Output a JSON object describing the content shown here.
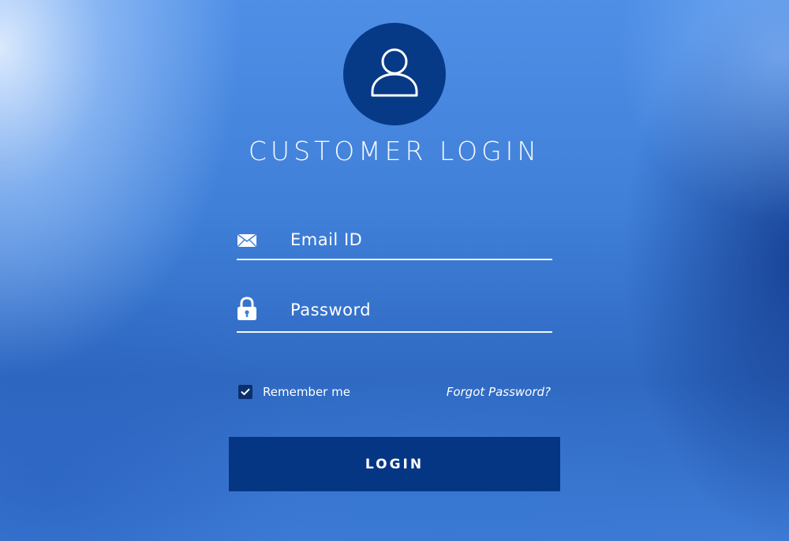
{
  "header": {
    "title": "CUSTOMER LOGIN",
    "avatar_icon": "user-icon",
    "avatar_color": "#063a87"
  },
  "form": {
    "email": {
      "placeholder": "Email ID",
      "value": "",
      "icon": "envelope-icon"
    },
    "password": {
      "placeholder": "Password",
      "value": "",
      "icon": "lock-icon"
    },
    "remember": {
      "label": "Remember me",
      "checked": true
    },
    "forgot_label": "Forgot Password?",
    "login_label": "LOGIN"
  },
  "colors": {
    "button": "#053683",
    "checkbox": "#0c2f6e",
    "text": "#ffffff"
  }
}
